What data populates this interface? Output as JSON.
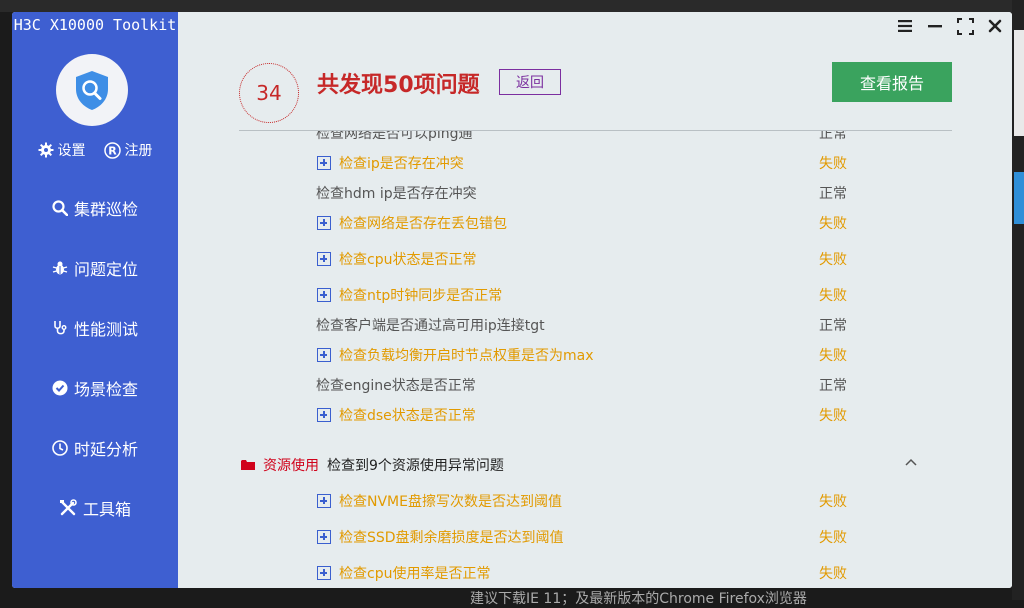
{
  "app": {
    "title": "H3C X10000 Toolkit"
  },
  "sidebar": {
    "settings_label": "设置",
    "register_label": "注册",
    "nav": [
      {
        "label": "集群巡检",
        "icon": "search-icon"
      },
      {
        "label": "问题定位",
        "icon": "bug-icon"
      },
      {
        "label": "性能测试",
        "icon": "stethoscope-icon"
      },
      {
        "label": "场景检查",
        "icon": "check-circle-icon"
      },
      {
        "label": "时延分析",
        "icon": "clock-icon"
      },
      {
        "label": "工具箱",
        "icon": "tools-icon"
      }
    ]
  },
  "header": {
    "count_badge": "34",
    "headline_prefix": "共发现",
    "headline_num": "50",
    "headline_suffix": "项问题",
    "back_label": "返回",
    "report_label": "查看报告"
  },
  "results": {
    "partial_top_label": "检查网络是否可以ping通",
    "partial_top_status": "正常",
    "rows": [
      {
        "label": "检查ip是否存在冲突",
        "status": "失败",
        "state": "fail"
      },
      {
        "label": "检查hdm ip是否存在冲突",
        "status": "正常",
        "state": "ok"
      },
      {
        "label": "检查网络是否存在丢包错包",
        "status": "失败",
        "state": "fail"
      },
      {
        "label": "检查cpu状态是否正常",
        "status": "失败",
        "state": "fail"
      },
      {
        "label": "检查ntp时钟同步是否正常",
        "status": "失败",
        "state": "fail"
      },
      {
        "label": "检查客户端是否通过高可用ip连接tgt",
        "status": "正常",
        "state": "ok"
      },
      {
        "label": "检查负载均衡开启时节点权重是否为max",
        "status": "失败",
        "state": "fail"
      },
      {
        "label": "检查engine状态是否正常",
        "status": "正常",
        "state": "ok"
      },
      {
        "label": "检查dse状态是否正常",
        "status": "失败",
        "state": "fail"
      }
    ],
    "section": {
      "title": "资源使用",
      "desc": "检查到9个资源使用异常问题"
    },
    "section_rows": [
      {
        "label": "检查NVME盘擦写次数是否达到阈值",
        "status": "失败",
        "state": "fail"
      },
      {
        "label": "检查SSD盘剩余磨损度是否达到阈值",
        "status": "失败",
        "state": "fail"
      },
      {
        "label": "检查cpu使用率是否正常",
        "status": "失败",
        "state": "fail"
      }
    ]
  },
  "background": {
    "bottom_text": "建议下载IE 11；及最新版本的Chrome Firefox浏览器"
  },
  "colors": {
    "sidebar": "#3e5fd1",
    "fail": "#e29a00",
    "danger": "#c62828",
    "report": "#3aa35e"
  }
}
